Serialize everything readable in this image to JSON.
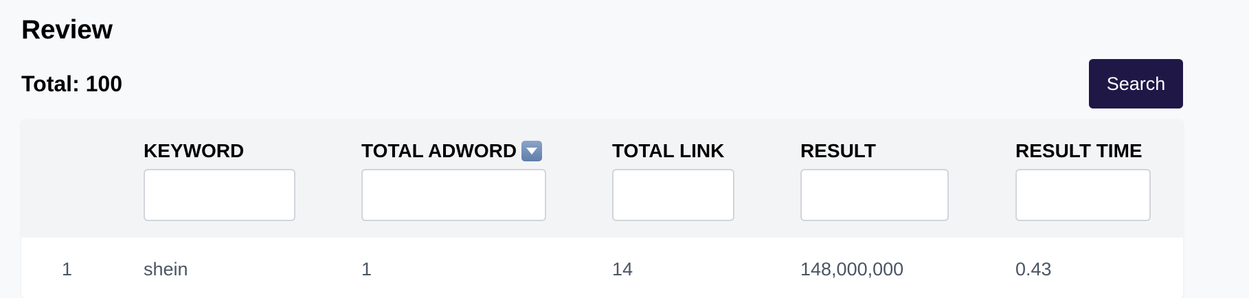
{
  "page": {
    "title": "Review",
    "total_label": "Total: 100",
    "search_label": "Search"
  },
  "table": {
    "columns": [
      {
        "label": "KEYWORD",
        "filter_value": ""
      },
      {
        "label": "TOTAL ADWORD",
        "filter_value": "",
        "sort_icon": "sort-down-icon"
      },
      {
        "label": "TOTAL LINK",
        "filter_value": ""
      },
      {
        "label": "RESULT",
        "filter_value": ""
      },
      {
        "label": "RESULT TIME",
        "filter_value": ""
      }
    ],
    "rows": [
      {
        "index": "1",
        "keyword": "shein",
        "total_adword": "1",
        "total_link": "14",
        "result": "148,000,000",
        "result_time": "0.43"
      }
    ]
  },
  "colors": {
    "accent": "#1f1847",
    "background": "#f8f9fb",
    "header_bg": "#f3f4f6"
  }
}
